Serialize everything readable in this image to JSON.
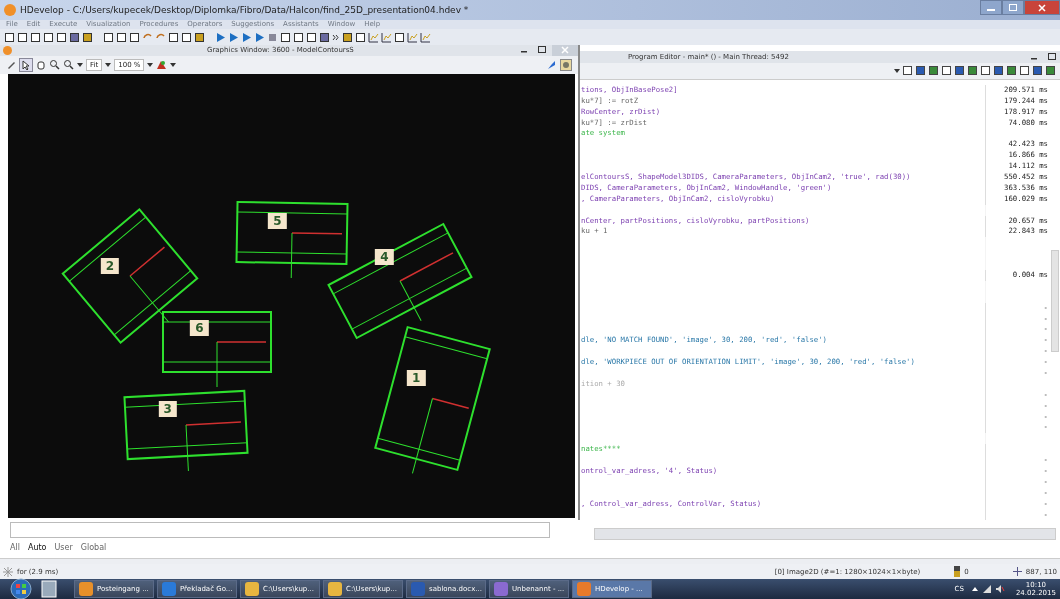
{
  "window": {
    "title": "HDevelop - C:/Users/kupecek/Desktop/Diplomka/Fibro/Data/Halcon/find_25D_presentation04.hdev *"
  },
  "menu": [
    {
      "label": "File",
      "disabled": true
    },
    {
      "label": "Edit",
      "disabled": true
    },
    {
      "label": "Execute",
      "disabled": true
    },
    {
      "label": "Visualization",
      "disabled": true
    },
    {
      "label": "Procedures",
      "disabled": true
    },
    {
      "label": "Operators",
      "disabled": true
    },
    {
      "label": "Suggestions",
      "disabled": true
    },
    {
      "label": "Assistants",
      "disabled": true
    },
    {
      "label": "Window",
      "disabled": true
    },
    {
      "label": "Help",
      "disabled": true
    }
  ],
  "graphics_window": {
    "title": "Graphics Window: 3600 - ModelContoursS",
    "zoom_mode": "Fit",
    "zoom_level": "100 %",
    "markers": [
      {
        "label": "1"
      },
      {
        "label": "2"
      },
      {
        "label": "3"
      },
      {
        "label": "4"
      },
      {
        "label": "5"
      },
      {
        "label": "6"
      }
    ]
  },
  "program_editor": {
    "title": "Program Editor - main* () - Main Thread: 5492",
    "lines": [
      {
        "code": "tions, ObjInBasePose2]",
        "kind": "call",
        "time": "209.571 ms"
      },
      {
        "code": "ku*7] := rotZ",
        "kind": "assign",
        "time": "179.244 ms"
      },
      {
        "code": "RowCenter, zrDist)",
        "kind": "call",
        "time": "178.917 ms"
      },
      {
        "code": "ku*7] := zrDist",
        "kind": "assign",
        "time": "74.080 ms"
      },
      {
        "code": "ate system",
        "kind": "comment"
      },
      {
        "time": "42.423 ms"
      },
      {
        "time": "16.866 ms"
      },
      {
        "time": "14.112 ms"
      },
      {
        "code": "elContoursS, ShapeModel3DIDS, CameraParameters, ObjInCam2, 'true', rad(30))",
        "kind": "call",
        "time": "550.452 ms"
      },
      {
        "code": "DIDS, CameraParameters, ObjInCam2, WindowHandle, 'green')",
        "kind": "call",
        "time": "363.536 ms"
      },
      {
        "code": ", CameraParameters, ObjInCam2, cisloVyrobku)",
        "kind": "call",
        "time": "160.029 ms"
      },
      {
        "kind": "blank"
      },
      {
        "code": "nCenter, partPositions, cisloVyrobku, partPositions)",
        "kind": "call",
        "time": "20.657 ms"
      },
      {
        "code": "ku + 1",
        "kind": "assign",
        "time": "22.843 ms"
      },
      {
        "kind": "blank"
      },
      {
        "kind": "blank"
      },
      {
        "kind": "blank"
      },
      {
        "time": "0.004 ms"
      },
      {
        "kind": "blank"
      },
      {
        "kind": "blank"
      },
      {
        "time": "-"
      },
      {
        "time": "-"
      },
      {
        "time": "-"
      },
      {
        "code": "dle, 'NO MATCH FOUND', 'image', 30, 200, 'red', 'false')",
        "kind": "string",
        "time": "-"
      },
      {
        "time": "-"
      },
      {
        "code": "dle, 'WORKPIECE OUT OF ORIENTATION LIMIT', 'image', 30, 200, 'red', 'false')",
        "kind": "string",
        "time": "-"
      },
      {
        "time": "-"
      },
      {
        "code": "ition + 30",
        "kind": "inactive"
      },
      {
        "time": "-"
      },
      {
        "time": "-"
      },
      {
        "time": "-"
      },
      {
        "time": "-"
      },
      {
        "kind": "blank"
      },
      {
        "code": "nates****",
        "kind": "comment"
      },
      {
        "time": "-"
      },
      {
        "code": "ontrol_var_adress, '4', Status)",
        "kind": "call",
        "time": "-"
      },
      {
        "time": "-"
      },
      {
        "time": "-"
      },
      {
        "code": ", Control_var_adress, ControlVar, Status)",
        "kind": "call",
        "time": "-"
      },
      {
        "time": "-"
      }
    ]
  },
  "variable_tabs": [
    {
      "label": "All",
      "selected": false
    },
    {
      "label": "Auto",
      "selected": true
    },
    {
      "label": "User",
      "selected": false
    },
    {
      "label": "Global",
      "selected": false
    }
  ],
  "status_bar": {
    "message": "for (2.9 ms)",
    "image_info": "[0] Image2D (#=1: 1280×1024×1×byte)",
    "count": "0",
    "coords": "887, 110"
  },
  "taskbar": {
    "apps": [
      {
        "label": "Posteingang ...",
        "active": false
      },
      {
        "label": "Překladač Go...",
        "active": false
      },
      {
        "label": "C:\\Users\\kup...",
        "active": false
      },
      {
        "label": "C:\\Users\\kup...",
        "active": false
      },
      {
        "label": "sablona.docx...",
        "active": false
      },
      {
        "label": "Unbenannt - ...",
        "active": false
      },
      {
        "label": "HDevelop - ...",
        "active": true
      }
    ],
    "language": "CS",
    "time": "10:10",
    "date": "24.02.2015"
  }
}
